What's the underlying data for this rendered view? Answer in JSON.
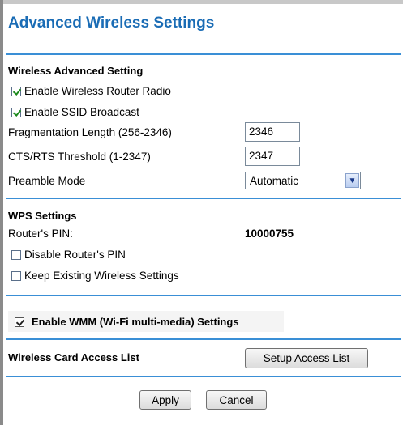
{
  "page": {
    "title": "Advanced Wireless Settings"
  },
  "wireless_advanced": {
    "heading": "Wireless Advanced Setting",
    "enable_radio": {
      "label": "Enable Wireless Router Radio",
      "checked": true
    },
    "enable_ssid": {
      "label": "Enable SSID Broadcast",
      "checked": true
    },
    "fragmentation": {
      "label": "Fragmentation Length (256-2346)",
      "value": "2346"
    },
    "cts_rts": {
      "label": "CTS/RTS Threshold (1-2347)",
      "value": "2347"
    },
    "preamble": {
      "label": "Preamble Mode",
      "value": "Automatic"
    }
  },
  "wps": {
    "heading": "WPS Settings",
    "pin_label": "Router's PIN:",
    "pin_value": "10000755",
    "disable_pin": {
      "label": "Disable Router's PIN",
      "checked": false
    },
    "keep_existing": {
      "label": "Keep Existing Wireless Settings",
      "checked": false
    }
  },
  "wmm": {
    "label": "Enable WMM (Wi-Fi multi-media) Settings",
    "checked": true
  },
  "access_list": {
    "label": "Wireless Card Access List",
    "button": "Setup Access List"
  },
  "actions": {
    "apply": "Apply",
    "cancel": "Cancel"
  },
  "colors": {
    "title": "#1a6cb5",
    "rule": "#3a8fd6",
    "checkmark": "#1d8a1d"
  }
}
